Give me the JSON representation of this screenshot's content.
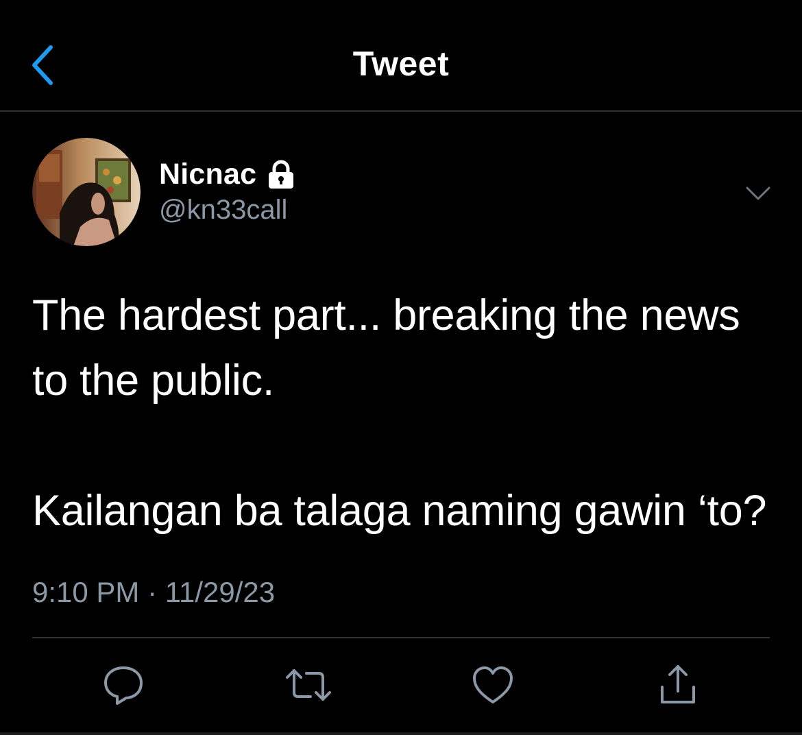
{
  "header": {
    "title": "Tweet",
    "back_icon": "chevron-left-icon",
    "accent_color": "#1d9bf0"
  },
  "author": {
    "display_name": "Nicnac",
    "handle": "@kn33call",
    "protected_icon": "lock-icon",
    "avatar_icon": "avatar-photo",
    "more_icon": "chevron-down-icon"
  },
  "tweet": {
    "line1": "The hardest part... breaking the news to the public.",
    "line2": "Kailangan ba talaga naming gawin ‘to?",
    "time": "9:10 PM",
    "separator": "·",
    "date": "11/29/23"
  },
  "actions": [
    {
      "name": "reply",
      "icon": "reply-icon"
    },
    {
      "name": "retweet",
      "icon": "retweet-icon"
    },
    {
      "name": "like",
      "icon": "heart-icon"
    },
    {
      "name": "share",
      "icon": "share-icon"
    }
  ],
  "colors": {
    "background": "#000000",
    "text": "#ffffff",
    "secondary_text": "#8b98a5",
    "divider": "#2f3336"
  }
}
